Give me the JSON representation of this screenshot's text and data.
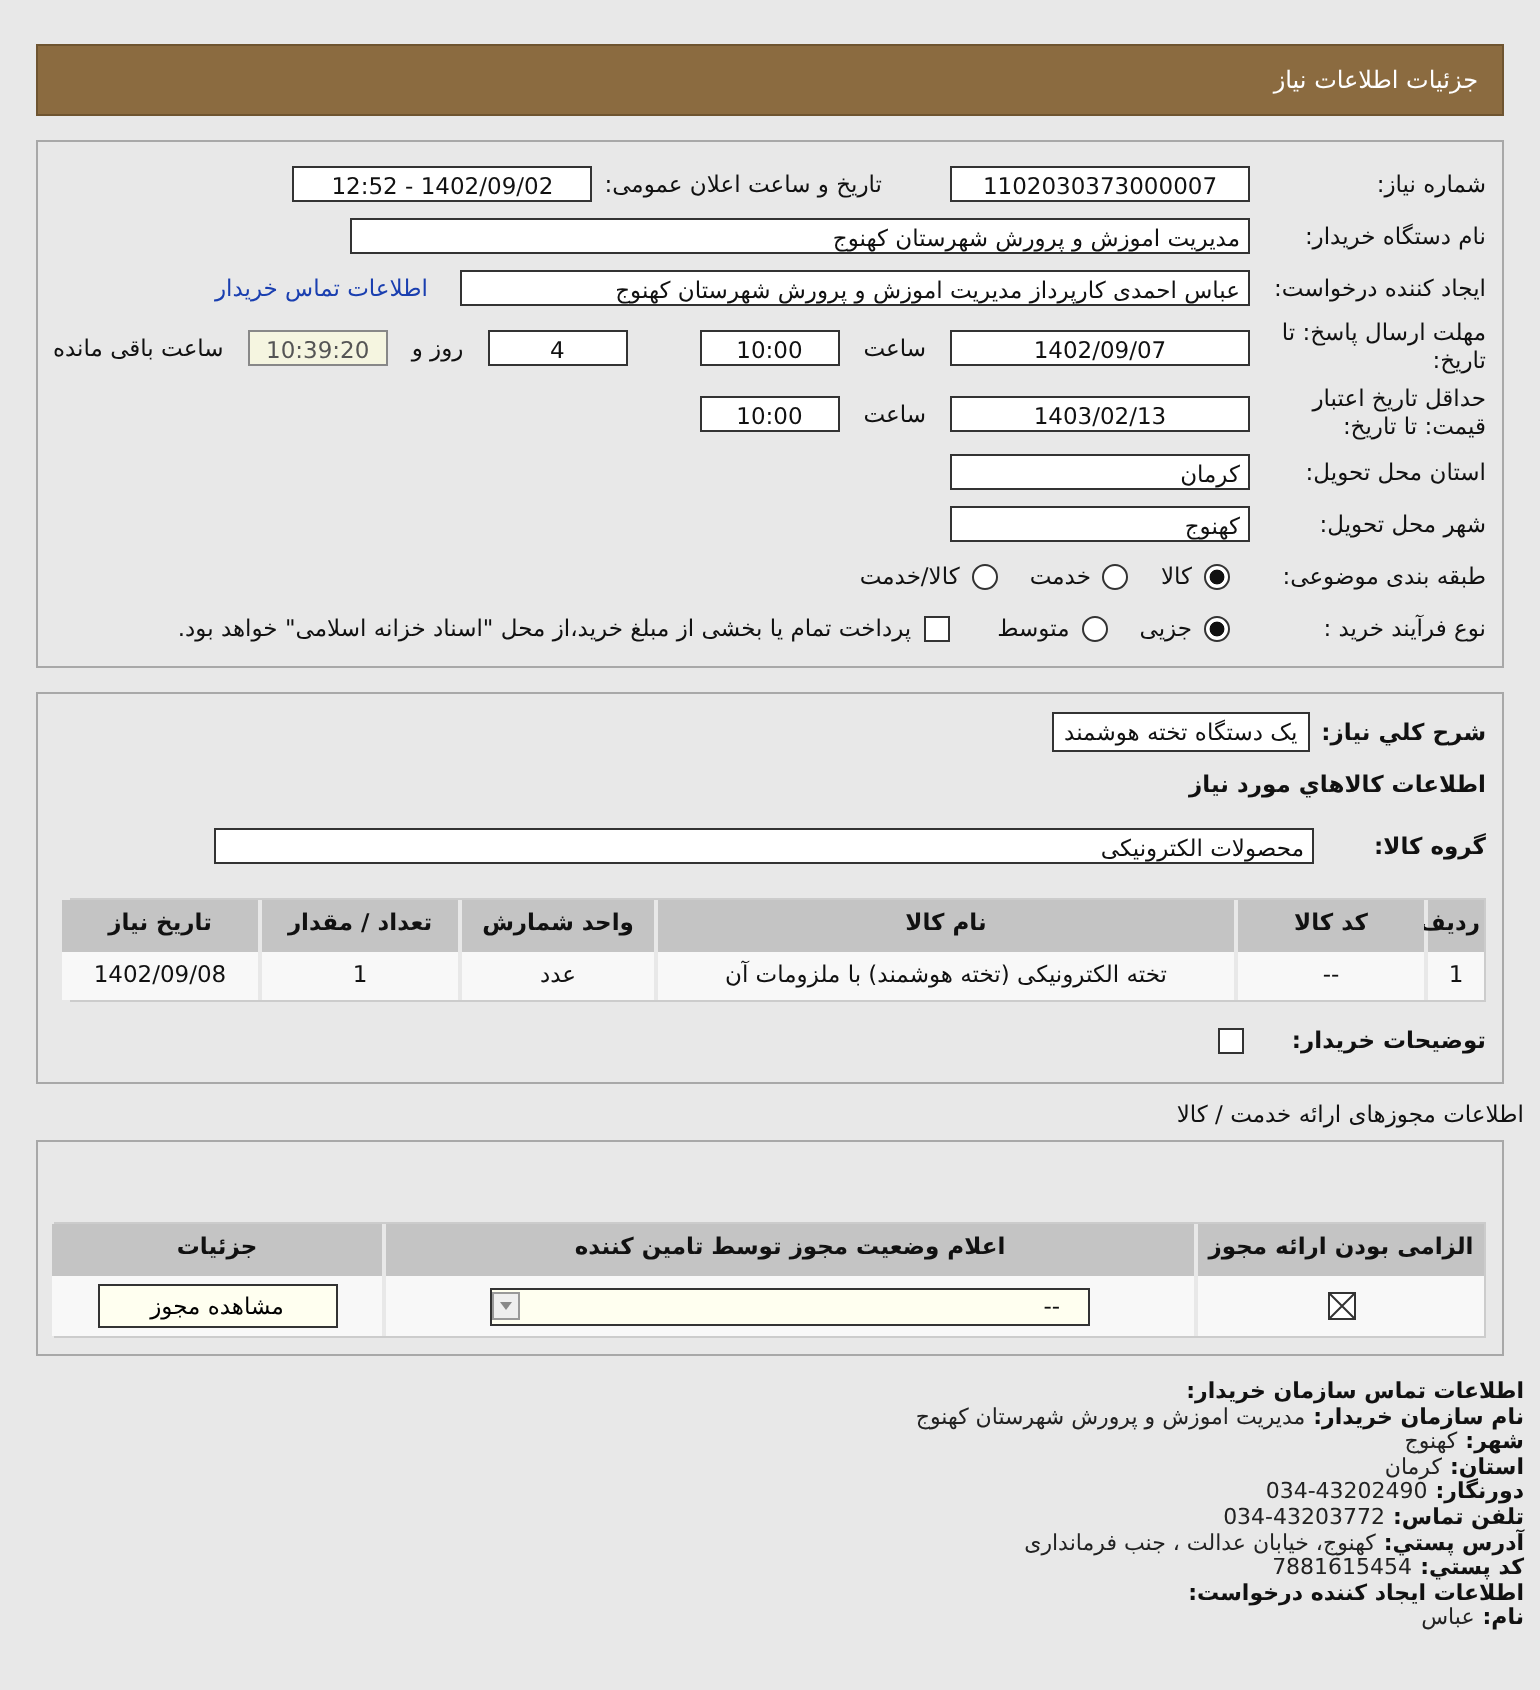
{
  "header": {
    "title": "جزئیات اطلاعات نیاز"
  },
  "need": {
    "number": {
      "label": "شماره نیاز:",
      "value": "1102030373000007"
    },
    "announce": {
      "label": "تاریخ و ساعت اعلان عمومی:",
      "value": "1402/09/02 - 12:52"
    },
    "buyer": {
      "label": "نام دستگاه خریدار:",
      "value": "مدیریت اموزش و پرورش شهرستان کهنوج"
    },
    "requester": {
      "label": "ایجاد کننده درخواست:",
      "value": "عباس احمدی کارپرداز مدیریت اموزش و پرورش شهرستان کهنوج",
      "link": "اطلاعات تماس خریدار"
    },
    "deadline": {
      "label": "مهلت ارسال پاسخ: تا تاریخ:",
      "date": "1402/09/07",
      "time_label": "ساعت",
      "time": "10:00",
      "days": "4",
      "days_label": "روز و",
      "remaining": "10:39:20",
      "remaining_label": "ساعت باقی مانده"
    },
    "validity": {
      "label": "حداقل تاریخ اعتبار قیمت: تا تاریخ:",
      "date": "1403/02/13",
      "time_label": "ساعت",
      "time": "10:00"
    },
    "province": {
      "label": "استان محل تحویل:",
      "value": "کرمان"
    },
    "city": {
      "label": "شهر محل تحویل:",
      "value": "کهنوج"
    },
    "category": {
      "label": "طبقه بندی موضوعی:",
      "options": [
        {
          "label": "کالا",
          "selected": true
        },
        {
          "label": "خدمت",
          "selected": false
        },
        {
          "label": "کالا/خدمت",
          "selected": false
        }
      ]
    },
    "purchase": {
      "label": "نوع فرآیند خرید :",
      "options": [
        {
          "label": "جزیی",
          "selected": true
        },
        {
          "label": "متوسط",
          "selected": false
        }
      ],
      "payment": {
        "label": "پرداخت تمام یا بخشی از مبلغ خرید،از محل \"اسناد خزانه اسلامی\" خواهد بود.",
        "checked": false
      }
    }
  },
  "goods": {
    "description": {
      "label": "شرح کلي نياز:",
      "value": "یک دستگاه تخته هوشمند"
    },
    "title": "اطلاعات کالاهاي مورد نياز",
    "group": {
      "label": "گروه کالا:",
      "value": "محصولات الکترونیکی"
    },
    "table": {
      "columns": [
        "ردیف",
        "کد کالا",
        "نام کالا",
        "واحد شمارش",
        "تعداد / مقدار",
        "تاریخ نیاز"
      ],
      "rows": [
        [
          "1",
          "--",
          "تخته الکترونیکی (تخته هوشمند) با ملزومات آن",
          "عدد",
          "1",
          "1402/09/08"
        ]
      ]
    },
    "buyer_notes": {
      "label": "توضیحات خریدار:",
      "checked": false
    }
  },
  "licenses": {
    "title": "اطلاعات مجوزهای ارائه خدمت / کالا",
    "columns": [
      "الزامی بودن ارائه مجوز",
      "اعلام وضعیت مجوز توسط تامین کننده",
      "جزئیات"
    ],
    "rows": [
      {
        "required": true,
        "status": "--",
        "button": "مشاهده مجوز"
      }
    ]
  },
  "contact": [
    {
      "kind": "heading",
      "text": "اطلاعات تماس سازمان خریدار:"
    },
    {
      "kind": "pair",
      "label": "نام سازمان خریدار:",
      "value": "مدیریت اموزش و پرورش شهرستان کهنوج"
    },
    {
      "kind": "pair",
      "label": "شهر:",
      "value": "کهنوج"
    },
    {
      "kind": "pair",
      "label": "استان:",
      "value": "کرمان"
    },
    {
      "kind": "pair",
      "label": "دورنگار:",
      "value": "034-43202490"
    },
    {
      "kind": "pair",
      "label": "تلفن تماس:",
      "value": "034-43203772"
    },
    {
      "kind": "pair",
      "label": "آدرس پستي:",
      "value": "کهنوج، خیابان عدالت ، جنب فرمانداری"
    },
    {
      "kind": "pair",
      "label": "کد پستي:",
      "value": "7881615454"
    },
    {
      "kind": "heading",
      "text": "اطلاعات ایجاد کننده درخواست:"
    },
    {
      "kind": "pair",
      "label": "نام:",
      "value": "عباس"
    }
  ]
}
